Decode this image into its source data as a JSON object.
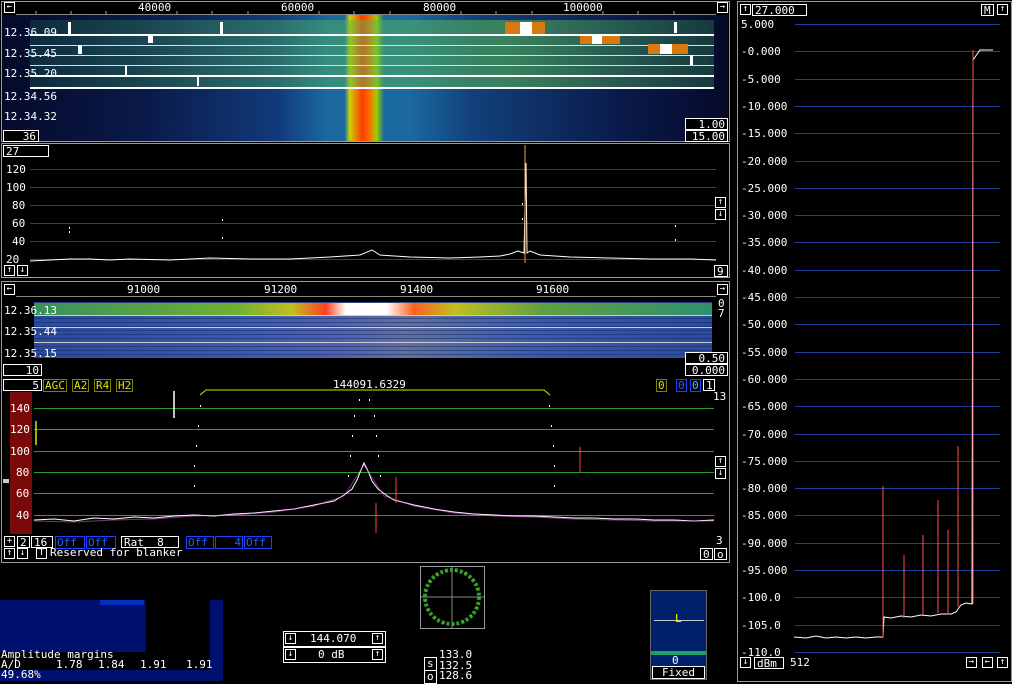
{
  "wide_waterfall": {
    "freq_ticks": [
      "40000",
      "60000",
      "80000",
      "100000"
    ],
    "times": [
      "12.36.09",
      "12.35.45",
      "12.35.20",
      "12.34.56",
      "12.34.32"
    ],
    "box_left": "36",
    "box_r1": "1.00",
    "box_r2": "15.00"
  },
  "wide_spectrum": {
    "box_top": "27",
    "ylabels": [
      "120",
      "100",
      "80",
      "60",
      "40",
      "20"
    ],
    "box_right": "9"
  },
  "hires_waterfall": {
    "freq_ticks": [
      "91000",
      "91200",
      "91400",
      "91600"
    ],
    "times": [
      "12.36.13",
      "12.35.44",
      "12.35.15"
    ],
    "right_top": "0",
    "right_2": "7",
    "box_left": "10",
    "box_r1": "0.50",
    "box_r2": "0.000"
  },
  "hires_spectrum": {
    "box_num": "5",
    "modes": [
      "AGC",
      "A2",
      "R4",
      "H2"
    ],
    "frequency": "144091.6329",
    "right_boxes": [
      "0",
      "0",
      "0",
      "1"
    ],
    "right_num": "13",
    "ylabels": [
      "140",
      "120",
      "100",
      "80",
      "60",
      "40"
    ],
    "bottom_btn": [
      "2",
      "16"
    ],
    "off1": "Off",
    "off2": "Off",
    "rat_label": "Rat",
    "rat_val": "8",
    "off3": "Off",
    "val4": "4",
    "off4": "Off",
    "right_3": "3",
    "reserved": "Reserved for blanker",
    "corner_0": "0",
    "corner_o": "o"
  },
  "amplitude": {
    "title": "Amplitude margins",
    "ad_label": "A/D",
    "ad_values": [
      "1.78",
      "1.84",
      "1.91",
      "1.91"
    ],
    "percent": "49.68%"
  },
  "freq_control": {
    "freq": "144.070",
    "gain": "0 dB"
  },
  "s_meter": {
    "s_label": "s",
    "o_label": "o",
    "values": [
      "133.0",
      "132.5",
      "128.6"
    ]
  },
  "fixed_panel": {
    "label": "L",
    "value": "0",
    "mode": "Fixed"
  },
  "baseband": {
    "top_value": "27.000",
    "m_label": "M",
    "db_labels": [
      "5.000",
      "-0.000",
      "-5.000",
      "-10.000",
      "-15.000",
      "-20.000",
      "-25.000",
      "-30.000",
      "-35.000",
      "-40.000",
      "-45.000",
      "-50.000",
      "-55.000",
      "-60.000",
      "-65.000",
      "-70.000",
      "-75.000",
      "-80.000",
      "-85.000",
      "-90.000",
      "-95.000",
      "-100.0",
      "-105.0",
      "-110.0"
    ],
    "unit": "dBm",
    "points": "512"
  }
}
